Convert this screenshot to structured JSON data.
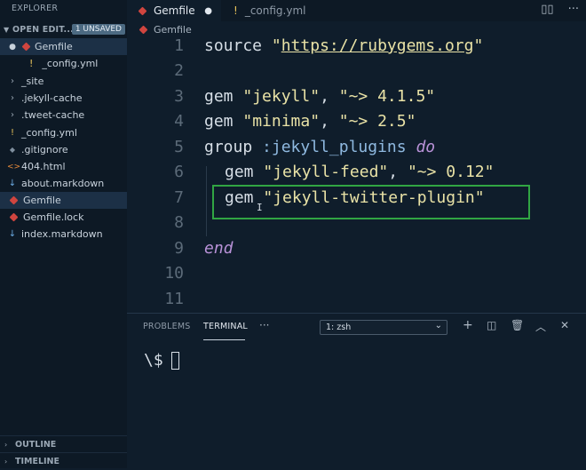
{
  "sidebar": {
    "title": "EXPLORER",
    "open_editors": {
      "label": "OPEN EDIT...",
      "badge": "1 UNSAVED",
      "items": [
        {
          "icon": "●",
          "name": "Gemfile"
        },
        {
          "icon": "!",
          "name": "_config.yml"
        }
      ]
    },
    "files": [
      {
        "icon": "›",
        "name": "_site"
      },
      {
        "icon": "›",
        "name": ".jekyll-cache"
      },
      {
        "icon": "›",
        "name": ".tweet-cache"
      },
      {
        "icon": "!",
        "name": "_config.yml"
      },
      {
        "icon": "◆",
        "name": ".gitignore"
      },
      {
        "icon": "<>",
        "name": "404.html"
      },
      {
        "icon": "↓",
        "name": "about.markdown"
      },
      {
        "icon": "◆",
        "name": "Gemfile"
      },
      {
        "icon": "◆",
        "name": "Gemfile.lock"
      },
      {
        "icon": "↓",
        "name": "index.markdown"
      }
    ],
    "outline_label": "OUTLINE",
    "timeline_label": "TIMELINE"
  },
  "tabs": [
    {
      "name": "Gemfile",
      "dirty_marker": "●"
    },
    {
      "icon": "!",
      "name": "_config.yml"
    }
  ],
  "breadcrumb": "Gemfile",
  "editor": {
    "line_numbers": [
      "1",
      "2",
      "3",
      "4",
      "5",
      "6",
      "7",
      "8",
      "9",
      "10",
      "11"
    ],
    "lines": {
      "l1_kw": "source",
      "l1_q1": "\"",
      "l1_url": "https://rubygems.org",
      "l1_q2": "\"",
      "l3_kw": "gem",
      "l3_s1": "\"jekyll\"",
      "l3_c": ", ",
      "l3_s2": "\"~> 4.1.5\"",
      "l4_kw": "gem",
      "l4_s1": "\"minima\"",
      "l4_c": ", ",
      "l4_s2": "\"~> 2.5\"",
      "l5_kw": "group",
      "l5_sym": ":jekyll_plugins",
      "l5_do": "do",
      "l6_kw": "gem",
      "l6_s1": "\"jekyll-feed\"",
      "l6_c": ", ",
      "l6_s2": "\"~> 0.12\"",
      "l7_kw": "gem",
      "l7_s1": "\"jekyll-twitter-plugin\"",
      "l9_end": "end"
    },
    "highlight_color": "#31a543"
  },
  "panel": {
    "tabs": [
      "PROBLEMS",
      "TERMINAL"
    ],
    "more": "···",
    "terminal_select": "1: zsh",
    "prompt": "\\$"
  }
}
